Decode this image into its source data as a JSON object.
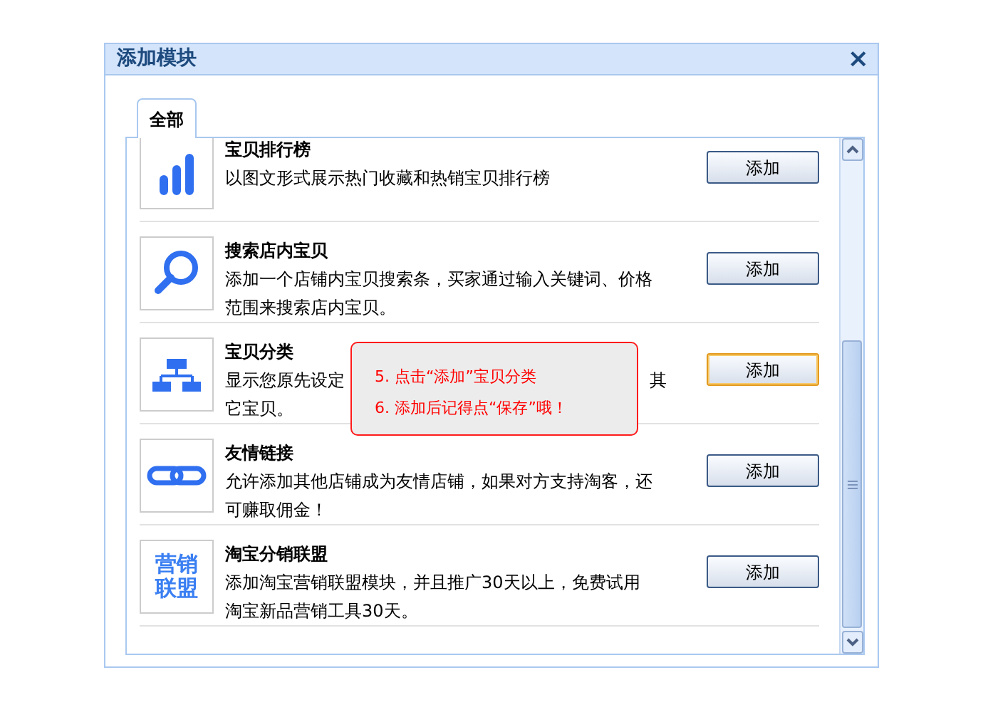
{
  "dialog": {
    "title": "添加模块",
    "close": "×"
  },
  "tabs": [
    {
      "label": "全部",
      "selected": true
    }
  ],
  "modules": [
    {
      "kind": "bars",
      "name": "宝贝排行榜",
      "description": [
        "以图文形式展示热门收藏和热销宝贝排行榜"
      ],
      "button": "添加",
      "focused": false
    },
    {
      "kind": "search",
      "name": "搜索店内宝贝",
      "description": [
        "添加一个店铺内宝贝搜索条，买家通过输入关键词、价格范围来搜索店内宝贝。"
      ],
      "button": "添加",
      "focused": false
    },
    {
      "kind": "tree",
      "name": "宝贝分类",
      "description": [
        "显示您原先设定",
        "其",
        "它宝贝。"
      ],
      "button": "添加",
      "focused": true
    },
    {
      "kind": "link",
      "name": "友情链接",
      "description": [
        "允许添加其他店铺成为友情店铺，如果对方支持淘客，还可赚取佣金！"
      ],
      "button": "添加",
      "focused": false
    },
    {
      "kind": "text",
      "icon_text": [
        "营销",
        "联盟"
      ],
      "name": "淘宝分销联盟",
      "description": [
        "添加淘宝营销联盟模块，并且推广30天以上，免费试用淘宝新品营销工具30天。"
      ],
      "button": "添加",
      "focused": false
    }
  ],
  "tooltip": {
    "lines": [
      "5. 点击“添加”宝贝分类",
      "6. 添加后记得点“保存”哦！"
    ]
  }
}
